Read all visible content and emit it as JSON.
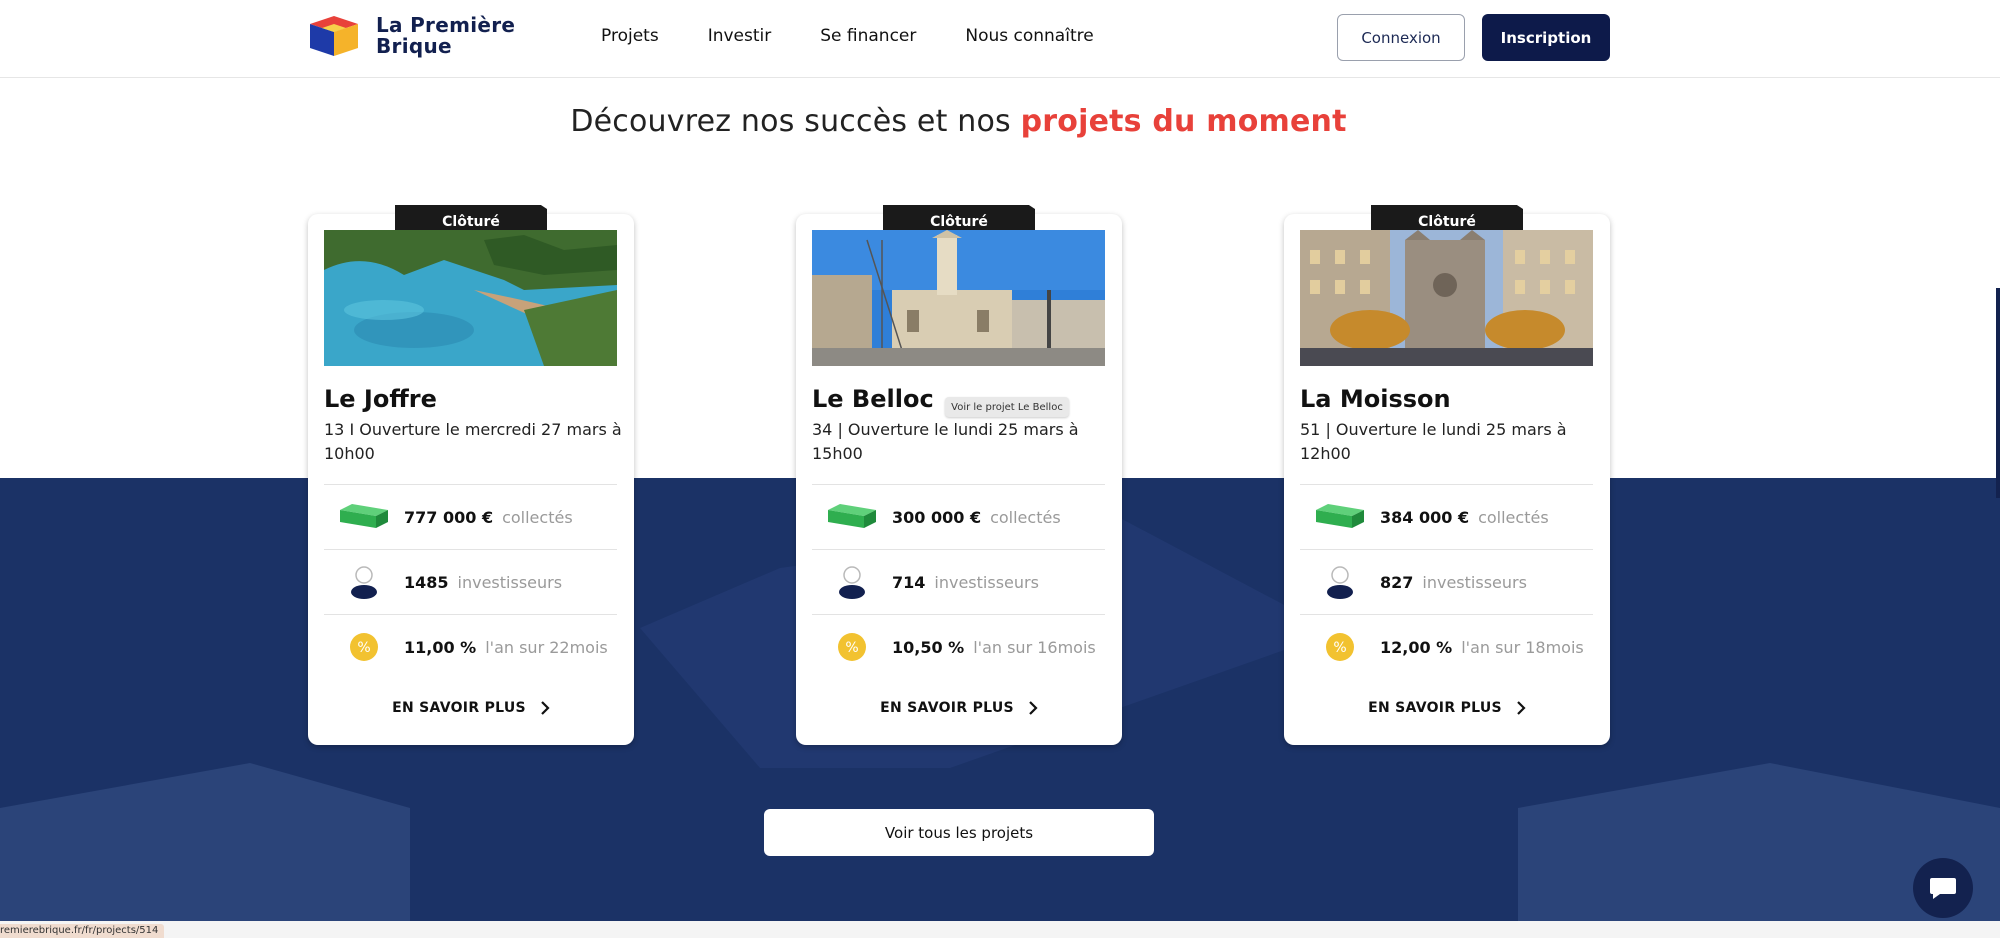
{
  "header": {
    "logo_line1": "La Première",
    "logo_line2": "Brique",
    "nav": [
      "Projets",
      "Investir",
      "Se financer",
      "Nous connaître"
    ],
    "login_label": "Connexion",
    "signup_label": "Inscription"
  },
  "section": {
    "title_part1": "Découvrez nos succès et nos ",
    "title_highlight": "projets du moment"
  },
  "projects": [
    {
      "status": "Clôturé",
      "name": "Le Joffre",
      "subtitle": "13 I Ouverture le mercredi 27 mars à 10h00",
      "amount": "777 000 €",
      "amount_label": "collectés",
      "investors": "1485",
      "investors_label": "investisseurs",
      "rate": "11,00 %",
      "rate_label": "l'an sur 22mois",
      "more_label": "EN SAVOIR PLUS",
      "image": "coastal-cove-photo"
    },
    {
      "status": "Clôturé",
      "name": "Le Belloc",
      "subtitle": "34 | Ouverture le lundi 25 mars à 15h00",
      "amount": "300 000 €",
      "amount_label": "collectés",
      "investors": "714",
      "investors_label": "investisseurs",
      "rate": "10,50 %",
      "rate_label": "l'an sur 16mois",
      "more_label": "EN SAVOIR PLUS",
      "image": "building-construction-photo"
    },
    {
      "status": "Clôturé",
      "name": "La Moisson",
      "subtitle": "51 | Ouverture le lundi 25 mars à 12h00",
      "amount": "384 000 €",
      "amount_label": "collectés",
      "investors": "827",
      "investors_label": "investisseurs",
      "rate": "12,00 %",
      "rate_label": "l'an sur 18mois",
      "more_label": "EN SAVOIR PLUS",
      "image": "cathedral-street-photo"
    }
  ],
  "tooltip": "Voir le projet Le Belloc",
  "all_projects_label": "Voir tous les projets",
  "status_url": "remierebrique.fr/fr/projects/514",
  "colors": {
    "brand_navy": "#0d1a4a",
    "band_blue": "#1b3266",
    "highlight_red": "#e8413a",
    "money_green": "#2fae4f",
    "percent_yellow": "#f2c230"
  }
}
